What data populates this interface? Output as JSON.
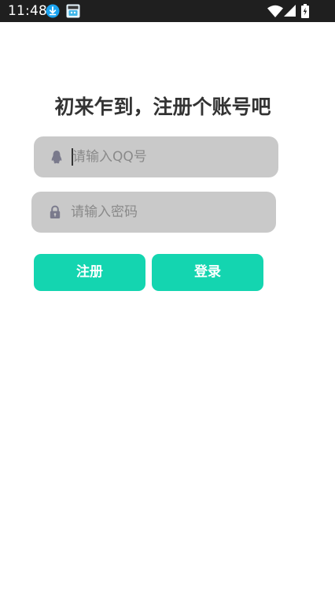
{
  "status_bar": {
    "time": "11:48",
    "icons": [
      "download-icon",
      "app-notification-icon",
      "wifi-icon",
      "cell-signal-icon",
      "battery-charging-icon"
    ]
  },
  "title": "初来乍到，注册个账号吧",
  "qq_input": {
    "icon": "qq-penguin-icon",
    "placeholder": "请输入QQ号",
    "value": ""
  },
  "password_input": {
    "icon": "lock-icon",
    "placeholder": "请输入密码",
    "value": ""
  },
  "buttons": {
    "register_label": "注册",
    "login_label": "登录"
  },
  "colors": {
    "status_bar": "#1f1f1f",
    "input_background": "#c9c9c9",
    "button_accent": "#14d5b0",
    "title_text": "#333333",
    "icon_tint": "#7a7a8c"
  }
}
